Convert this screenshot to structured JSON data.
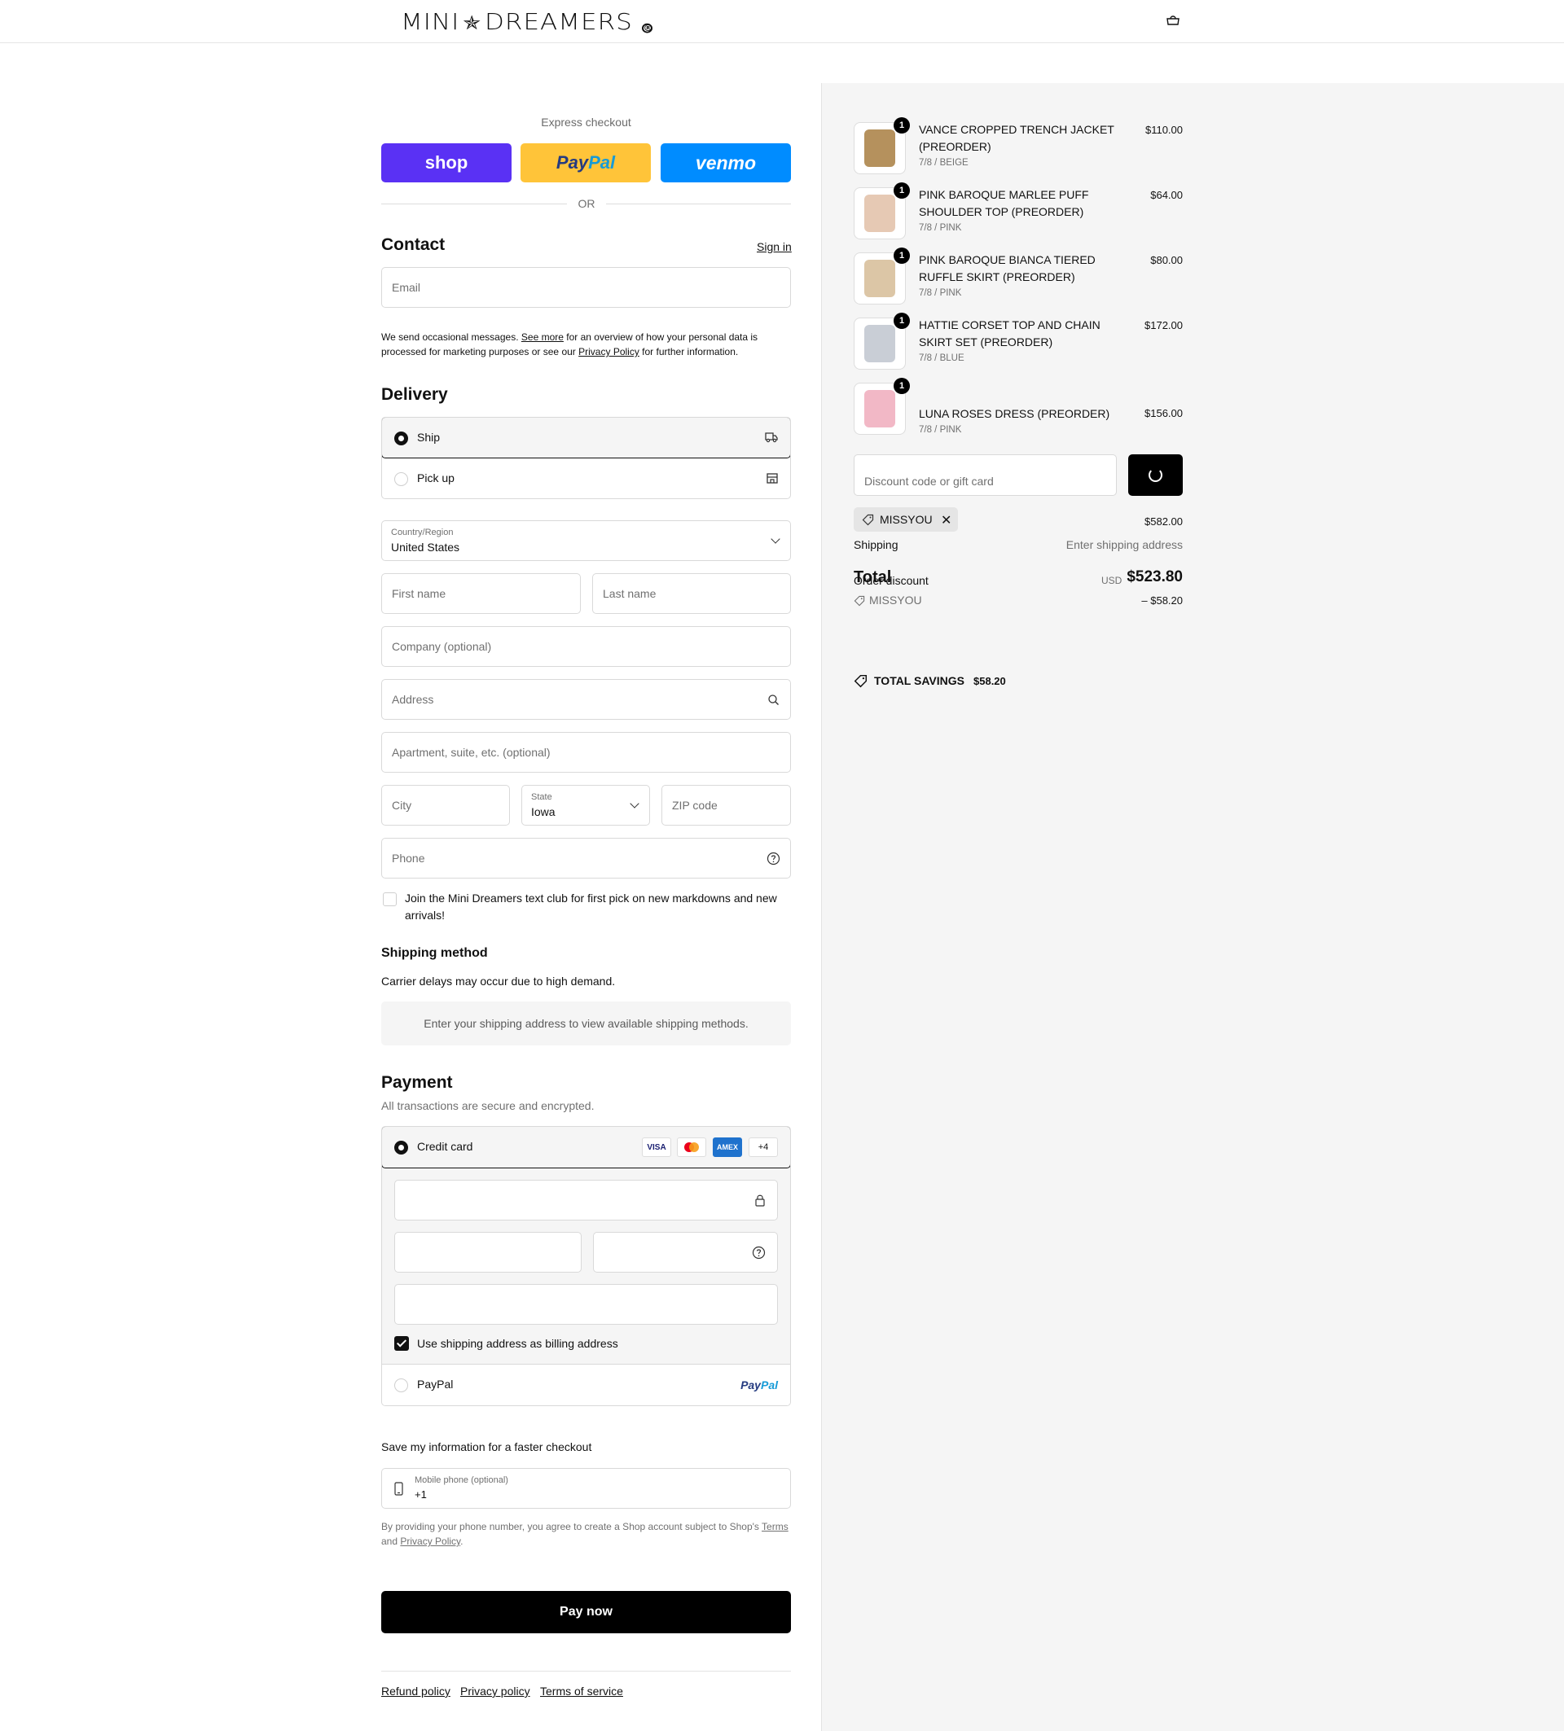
{
  "header": {
    "logo_text": "MINI",
    "logo_star": "✯",
    "logo_text2": "DREAMERS",
    "logo_reg": "®",
    "cart_icon": "cart-icon"
  },
  "express": {
    "label": "Express checkout",
    "shop_label": "shop",
    "paypal_label_a": "Pay",
    "paypal_label_b": "Pal",
    "venmo_label": "venmo",
    "or_text": "OR"
  },
  "contact": {
    "title": "Contact",
    "sign_in": "Sign in",
    "email_placeholder": "Email",
    "notice_pre": "We send occasional messages.",
    "notice_link1": "See more",
    "notice_mid": "for an overview of how your personal data is processed for marketing purposes or see our",
    "notice_link2": "Privacy Policy",
    "notice_post": "for further information."
  },
  "delivery": {
    "title": "Delivery",
    "ship_label": "Ship",
    "pickup_label": "Pick up",
    "country_label": "Country/Region",
    "country_value": "United States",
    "first_name": "First name",
    "last_name": "Last name",
    "company": "Company (optional)",
    "address": "Address",
    "apartment": "Apartment, suite, etc. (optional)",
    "city": "City",
    "state_label": "State",
    "state_value": "Iowa",
    "zip": "ZIP code",
    "phone": "Phone",
    "text_club": "Join the Mini Dreamers text club for first pick on new markdowns and new arrivals!"
  },
  "shipping_method": {
    "title": "Shipping method",
    "note": "Carrier delays may occur due to high demand.",
    "placeholder": "Enter your shipping address to view available shipping methods."
  },
  "payment": {
    "title": "Payment",
    "subtitle": "All transactions are secure and encrypted.",
    "credit_card_label": "Credit card",
    "card_brands": [
      "VISA",
      "",
      "AMEX",
      "+4"
    ],
    "billing_label": "Use shipping address as billing address",
    "paypal_label": "PayPal",
    "paypal_logo_a": "Pay",
    "paypal_logo_b": "Pal"
  },
  "save_info": {
    "title": "Save my information for a faster checkout",
    "mobile_label": "Mobile phone (optional)",
    "mobile_value": "+1",
    "consent_pre": "By providing your phone number, you agree to create a Shop account subject to Shop's",
    "terms": "Terms",
    "and": "and",
    "privacy": "Privacy Policy",
    "period": "."
  },
  "pay_now": "Pay now",
  "footer": {
    "refund": "Refund policy",
    "privacy": "Privacy policy",
    "terms": "Terms of service"
  },
  "summary": {
    "items": [
      {
        "name": "VANCE CROPPED TRENCH JACKET (PREORDER)",
        "variant": "7/8 / BEIGE",
        "price": "$110.00",
        "qty": "1",
        "color": "#b5915d"
      },
      {
        "name": "PINK BAROQUE MARLEE PUFF SHOULDER TOP (PREORDER)",
        "variant": "7/8 / PINK",
        "price": "$64.00",
        "qty": "1",
        "color": "#e6c9b4"
      },
      {
        "name": "PINK BAROQUE BIANCA TIERED RUFFLE SKIRT (PREORDER)",
        "variant": "7/8 / PINK",
        "price": "$80.00",
        "qty": "1",
        "color": "#dcc6a6"
      },
      {
        "name": "HATTIE CORSET TOP AND CHAIN SKIRT SET (PREORDER)",
        "variant": "7/8 / BLUE",
        "price": "$172.00",
        "qty": "1",
        "color": "#c9ced6"
      },
      {
        "name": "LUNA ROSES DRESS (PREORDER)",
        "variant": "7/8 / PINK",
        "price": "$156.00",
        "qty": "1",
        "color": "#f2b8c6"
      }
    ],
    "discount_placeholder": "Discount code or gift card",
    "applied_code": "MISSYOU",
    "subtotal_value": "$582.00",
    "shipping_label": "Shipping",
    "shipping_value": "Enter shipping address",
    "total_label": "Total",
    "order_discount_label": "Order discount",
    "currency": "USD",
    "total_value": "$523.80",
    "discount_code": "MISSYOU",
    "discount_value": "– $58.20",
    "savings_label": "TOTAL SAVINGS",
    "savings_value": "$58.20"
  }
}
